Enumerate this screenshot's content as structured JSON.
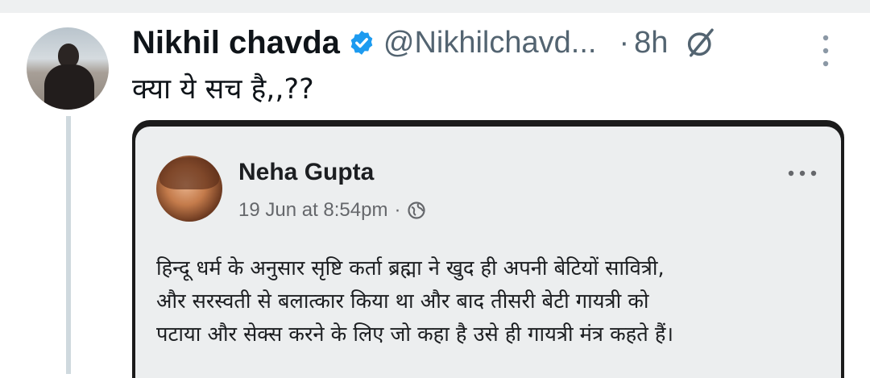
{
  "tweet": {
    "display_name": "Nikhil chavda",
    "handle": "@Nikhilchavd...",
    "separator": "·",
    "time": "8h",
    "text": "क्या ये सच है,,??",
    "icons": {
      "verified": "verified-badge-icon",
      "grok": "grok-icon",
      "more": "more-vertical-icon"
    },
    "colors": {
      "verified": "#1d9bf0",
      "secondary_text": "#536471",
      "thread_line": "#cfd9de"
    }
  },
  "embedded_post": {
    "author": "Neha Gupta",
    "timestamp": "19 Jun at 8:54pm",
    "separator": "·",
    "audience_icon": "globe-icon",
    "more_icon": "more-horizontal-icon",
    "body_lines": [
      "हिन्दू धर्म के अनुसार सृष्टि कर्ता ब्रह्मा ने खुद ही अपनी बेटियों सावित्री,",
      "और सरस्वती से बलात्कार किया था और बाद तीसरी बेटी गायत्री को",
      "पटाया और सेक्स करने के लिए जो कहा है उसे ही गायत्री मंत्र कहते हैं।"
    ]
  }
}
